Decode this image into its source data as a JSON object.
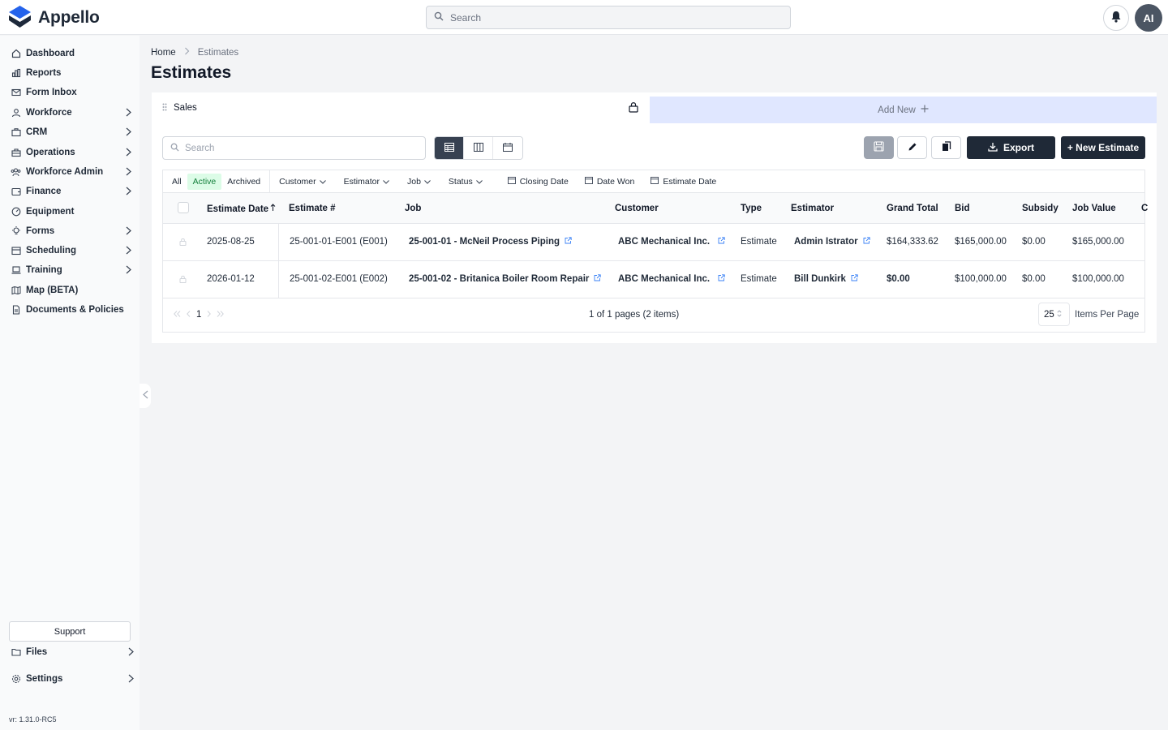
{
  "app": {
    "name": "Appello"
  },
  "topbar": {
    "search_placeholder": "Search",
    "avatar_initials": "AI"
  },
  "sidebar": {
    "items": [
      {
        "label": "Dashboard",
        "icon": "home-icon"
      },
      {
        "label": "Reports",
        "icon": "chart-icon"
      },
      {
        "label": "Form Inbox",
        "icon": "mail-icon"
      },
      {
        "label": "Workforce",
        "icon": "user-icon"
      },
      {
        "label": "CRM",
        "icon": "briefcase-icon"
      },
      {
        "label": "Operations",
        "icon": "toolbox-icon"
      },
      {
        "label": "Workforce Admin",
        "icon": "users-icon"
      },
      {
        "label": "Finance",
        "icon": "wallet-icon"
      },
      {
        "label": "Equipment",
        "icon": "gauge-icon"
      },
      {
        "label": "Forms",
        "icon": "bulb-icon"
      },
      {
        "label": "Scheduling",
        "icon": "calendar-icon"
      },
      {
        "label": "Training",
        "icon": "laptop-icon"
      },
      {
        "label": "Map (BETA)",
        "icon": "map-icon"
      },
      {
        "label": "Documents & Policies",
        "icon": "document-icon"
      }
    ],
    "support_label": "Support",
    "files_label": "Files",
    "settings_label": "Settings",
    "version": "vr: 1.31.0-RC5"
  },
  "breadcrumb": {
    "home": "Home",
    "current": "Estimates"
  },
  "page_title": "Estimates",
  "tabs": {
    "sales": "Sales",
    "add_new": "Add New"
  },
  "toolbar": {
    "search_placeholder": "Search",
    "export_label": "Export",
    "new_label": "+ New Estimate"
  },
  "filters": {
    "all": "All",
    "active": "Active",
    "archived": "Archived",
    "customer": "Customer",
    "estimator": "Estimator",
    "job": "Job",
    "status": "Status",
    "closing_date": "Closing Date",
    "date_won": "Date Won",
    "estimate_date": "Estimate Date"
  },
  "table": {
    "headers": {
      "estimate_date": "Estimate Date",
      "estimate_no": "Estimate #",
      "job": "Job",
      "customer": "Customer",
      "type": "Type",
      "estimator": "Estimator",
      "grand_total": "Grand Total",
      "bid": "Bid",
      "subsidy": "Subsidy",
      "job_value": "Job Value",
      "overflow": "C"
    },
    "rows": [
      {
        "estimate_date": "2025-08-25",
        "estimate_no": "25-001-01-E001 (E001)",
        "job": "25-001-01 - McNeil Process Piping",
        "customer": "ABC Mechanical Inc.",
        "type": "Estimate",
        "estimator": "Admin Istrator",
        "grand_total": "$164,333.62",
        "bid": "$165,000.00",
        "subsidy": "$0.00",
        "job_value": "$165,000.00"
      },
      {
        "estimate_date": "2026-01-12",
        "estimate_no": "25-001-02-E001 (E002)",
        "job": "25-001-02 - Britanica Boiler Room Repair",
        "customer": "ABC Mechanical Inc.",
        "type": "Estimate",
        "estimator": "Bill Dunkirk",
        "grand_total": "$0.00",
        "bid": "$100,000.00",
        "subsidy": "$0.00",
        "job_value": "$100,000.00"
      }
    ]
  },
  "pagination": {
    "current_page": "1",
    "info": "1 of 1 pages (2 items)",
    "page_size": "25",
    "page_size_label": "Items Per Page"
  },
  "colors": {
    "primary_dark": "#1f2937",
    "active_green": "#15803d",
    "link_blue": "#3b82f6",
    "add_tab_bg": "#e0e7ff"
  }
}
